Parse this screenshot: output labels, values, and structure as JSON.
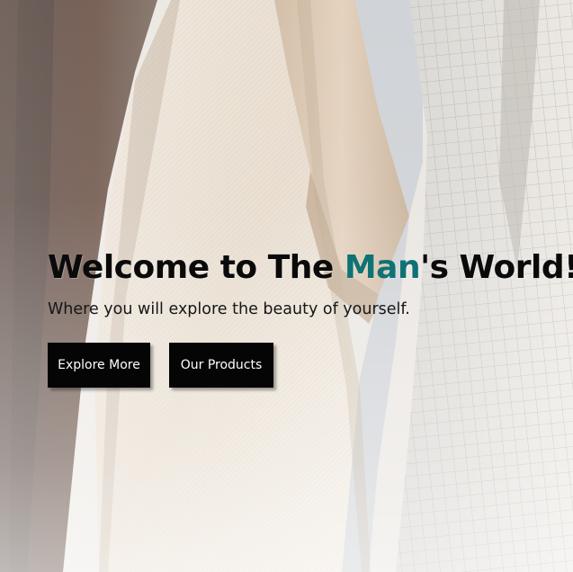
{
  "hero": {
    "headline_before": "Welcome to The ",
    "headline_accent": "Man",
    "headline_after": "'s World!",
    "subtitle": "Where you will explore the beauty of yourself.",
    "accent_color": "#0f7275",
    "background_image": "hanging-clothes-photo"
  },
  "buttons": {
    "explore_label": "Explore More",
    "products_label": "Our Products"
  }
}
